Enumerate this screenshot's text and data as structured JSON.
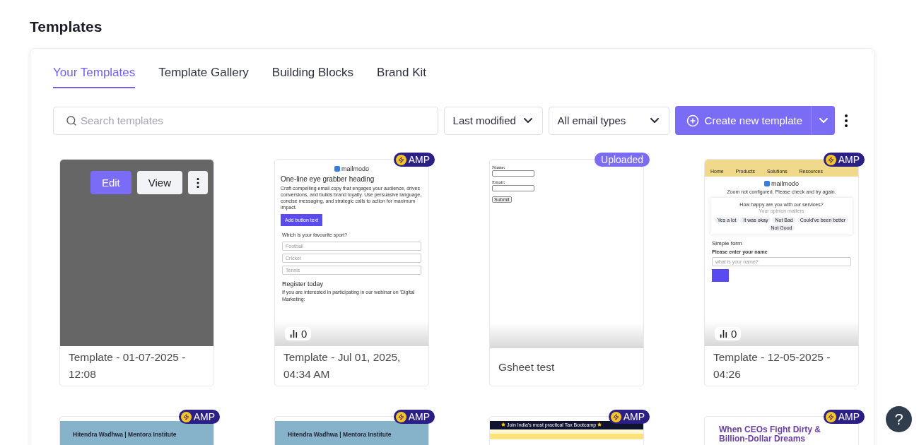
{
  "page_title": "Templates",
  "tabs": [
    {
      "label": "Your Templates",
      "selected": true
    },
    {
      "label": "Template Gallery",
      "selected": false
    },
    {
      "label": "Building Blocks",
      "selected": false
    },
    {
      "label": "Brand Kit",
      "selected": false
    }
  ],
  "search": {
    "placeholder": "Search templates"
  },
  "filters": [
    {
      "label": "Last modified"
    },
    {
      "label": "All email types"
    }
  ],
  "create_button": {
    "label": "Create new template"
  },
  "templates": [
    {
      "name": "Template - 01-07-2025 - 12:08",
      "hovered": true,
      "actions": [
        "Edit",
        "View"
      ],
      "preview": {
        "kind": "blank"
      }
    },
    {
      "name": "Template - Jul 01, 2025, 04:34 AM",
      "hovered": false,
      "badge": {
        "kind": "amp",
        "label": "AMP"
      },
      "stat": "0",
      "preview": {
        "kind": "article",
        "logo": "mailmodo",
        "heading": "One-line eye grabber heading",
        "body": "Craft compelling email copy that engages your audience, drives conversions, and builds brand loyalty. Use persuasive language, concise messaging, and strategic calls to action for maximum impact.",
        "button": "Add button text",
        "question": "Which is your favourite sport?",
        "options": [
          "Football",
          "Cricket",
          "Tennis"
        ],
        "subheading": "Register today",
        "tail": "If you are interested in participating in our webinar on 'Digital Marketing:"
      }
    },
    {
      "name": "Gsheet test",
      "hovered": false,
      "badge": {
        "kind": "uploaded",
        "label": "Uploaded"
      },
      "preview": {
        "kind": "form",
        "fields": [
          "Name:",
          "Email:"
        ],
        "button": "Submit"
      }
    },
    {
      "name": "Template - 12-05-2025 - 04:26",
      "hovered": false,
      "badge": {
        "kind": "amp",
        "label": "AMP"
      },
      "stat": "0",
      "preview": {
        "kind": "survey",
        "nav": [
          "Home",
          "Products",
          "Solutions",
          "Resources"
        ],
        "logo": "mailmodo",
        "notice": "Zoom not configured. Please check and try again.",
        "question": "How happy are you with our services?",
        "hint": "Your opinion matters",
        "choices": [
          "Yes a lot",
          "It was okay",
          "Not Bad",
          "Could've been better",
          "Not Good"
        ],
        "heading": "Simple form",
        "label": "Please enter your name",
        "placeholder": "what is your name?"
      }
    },
    {
      "hovered": false,
      "badge": {
        "kind": "amp",
        "label": "AMP"
      },
      "preview": {
        "kind": "banner",
        "text": "Hitendra Wadhwa | Mentora Institute"
      }
    },
    {
      "hovered": false,
      "badge": {
        "kind": "amp",
        "label": "AMP"
      },
      "preview": {
        "kind": "banner",
        "text": "Hitendra Wadhwa | Mentora Institute"
      }
    },
    {
      "hovered": false,
      "badge": {
        "kind": "amp",
        "label": "AMP"
      },
      "preview": {
        "kind": "stripes",
        "text": "Join India's most practical Tax Bootcamp"
      }
    },
    {
      "hovered": false,
      "badge": {
        "kind": "amp",
        "label": "AMP"
      },
      "preview": {
        "kind": "headline",
        "text": "When CEOs Fight Dirty & Billion-Dollar Dreams"
      }
    }
  ],
  "help_button": {
    "label": "?"
  }
}
